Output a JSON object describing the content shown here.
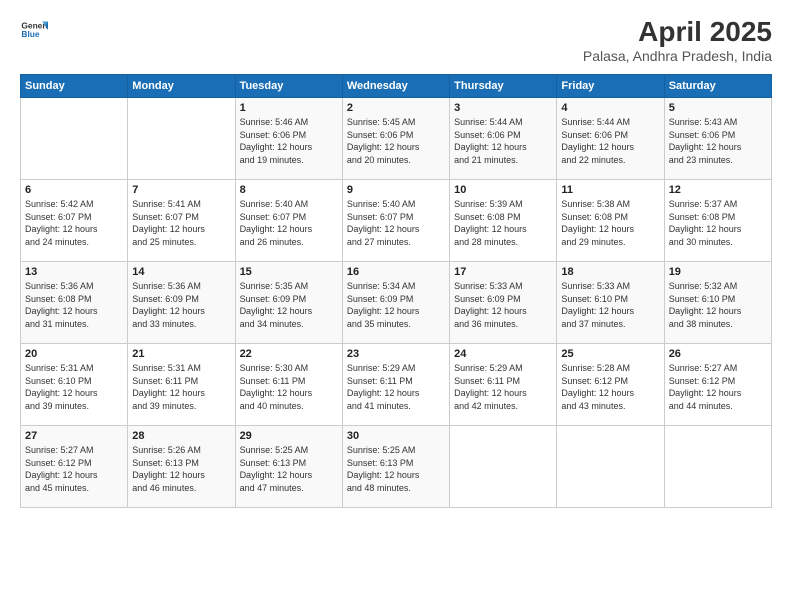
{
  "header": {
    "logo_general": "General",
    "logo_blue": "Blue",
    "title": "April 2025",
    "subtitle": "Palasa, Andhra Pradesh, India"
  },
  "columns": [
    "Sunday",
    "Monday",
    "Tuesday",
    "Wednesday",
    "Thursday",
    "Friday",
    "Saturday"
  ],
  "weeks": [
    {
      "days": [
        {
          "num": "",
          "info": ""
        },
        {
          "num": "",
          "info": ""
        },
        {
          "num": "1",
          "info": "Sunrise: 5:46 AM\nSunset: 6:06 PM\nDaylight: 12 hours\nand 19 minutes."
        },
        {
          "num": "2",
          "info": "Sunrise: 5:45 AM\nSunset: 6:06 PM\nDaylight: 12 hours\nand 20 minutes."
        },
        {
          "num": "3",
          "info": "Sunrise: 5:44 AM\nSunset: 6:06 PM\nDaylight: 12 hours\nand 21 minutes."
        },
        {
          "num": "4",
          "info": "Sunrise: 5:44 AM\nSunset: 6:06 PM\nDaylight: 12 hours\nand 22 minutes."
        },
        {
          "num": "5",
          "info": "Sunrise: 5:43 AM\nSunset: 6:06 PM\nDaylight: 12 hours\nand 23 minutes."
        }
      ]
    },
    {
      "days": [
        {
          "num": "6",
          "info": "Sunrise: 5:42 AM\nSunset: 6:07 PM\nDaylight: 12 hours\nand 24 minutes."
        },
        {
          "num": "7",
          "info": "Sunrise: 5:41 AM\nSunset: 6:07 PM\nDaylight: 12 hours\nand 25 minutes."
        },
        {
          "num": "8",
          "info": "Sunrise: 5:40 AM\nSunset: 6:07 PM\nDaylight: 12 hours\nand 26 minutes."
        },
        {
          "num": "9",
          "info": "Sunrise: 5:40 AM\nSunset: 6:07 PM\nDaylight: 12 hours\nand 27 minutes."
        },
        {
          "num": "10",
          "info": "Sunrise: 5:39 AM\nSunset: 6:08 PM\nDaylight: 12 hours\nand 28 minutes."
        },
        {
          "num": "11",
          "info": "Sunrise: 5:38 AM\nSunset: 6:08 PM\nDaylight: 12 hours\nand 29 minutes."
        },
        {
          "num": "12",
          "info": "Sunrise: 5:37 AM\nSunset: 6:08 PM\nDaylight: 12 hours\nand 30 minutes."
        }
      ]
    },
    {
      "days": [
        {
          "num": "13",
          "info": "Sunrise: 5:36 AM\nSunset: 6:08 PM\nDaylight: 12 hours\nand 31 minutes."
        },
        {
          "num": "14",
          "info": "Sunrise: 5:36 AM\nSunset: 6:09 PM\nDaylight: 12 hours\nand 33 minutes."
        },
        {
          "num": "15",
          "info": "Sunrise: 5:35 AM\nSunset: 6:09 PM\nDaylight: 12 hours\nand 34 minutes."
        },
        {
          "num": "16",
          "info": "Sunrise: 5:34 AM\nSunset: 6:09 PM\nDaylight: 12 hours\nand 35 minutes."
        },
        {
          "num": "17",
          "info": "Sunrise: 5:33 AM\nSunset: 6:09 PM\nDaylight: 12 hours\nand 36 minutes."
        },
        {
          "num": "18",
          "info": "Sunrise: 5:33 AM\nSunset: 6:10 PM\nDaylight: 12 hours\nand 37 minutes."
        },
        {
          "num": "19",
          "info": "Sunrise: 5:32 AM\nSunset: 6:10 PM\nDaylight: 12 hours\nand 38 minutes."
        }
      ]
    },
    {
      "days": [
        {
          "num": "20",
          "info": "Sunrise: 5:31 AM\nSunset: 6:10 PM\nDaylight: 12 hours\nand 39 minutes."
        },
        {
          "num": "21",
          "info": "Sunrise: 5:31 AM\nSunset: 6:11 PM\nDaylight: 12 hours\nand 39 minutes."
        },
        {
          "num": "22",
          "info": "Sunrise: 5:30 AM\nSunset: 6:11 PM\nDaylight: 12 hours\nand 40 minutes."
        },
        {
          "num": "23",
          "info": "Sunrise: 5:29 AM\nSunset: 6:11 PM\nDaylight: 12 hours\nand 41 minutes."
        },
        {
          "num": "24",
          "info": "Sunrise: 5:29 AM\nSunset: 6:11 PM\nDaylight: 12 hours\nand 42 minutes."
        },
        {
          "num": "25",
          "info": "Sunrise: 5:28 AM\nSunset: 6:12 PM\nDaylight: 12 hours\nand 43 minutes."
        },
        {
          "num": "26",
          "info": "Sunrise: 5:27 AM\nSunset: 6:12 PM\nDaylight: 12 hours\nand 44 minutes."
        }
      ]
    },
    {
      "days": [
        {
          "num": "27",
          "info": "Sunrise: 5:27 AM\nSunset: 6:12 PM\nDaylight: 12 hours\nand 45 minutes."
        },
        {
          "num": "28",
          "info": "Sunrise: 5:26 AM\nSunset: 6:13 PM\nDaylight: 12 hours\nand 46 minutes."
        },
        {
          "num": "29",
          "info": "Sunrise: 5:25 AM\nSunset: 6:13 PM\nDaylight: 12 hours\nand 47 minutes."
        },
        {
          "num": "30",
          "info": "Sunrise: 5:25 AM\nSunset: 6:13 PM\nDaylight: 12 hours\nand 48 minutes."
        },
        {
          "num": "",
          "info": ""
        },
        {
          "num": "",
          "info": ""
        },
        {
          "num": "",
          "info": ""
        }
      ]
    }
  ]
}
